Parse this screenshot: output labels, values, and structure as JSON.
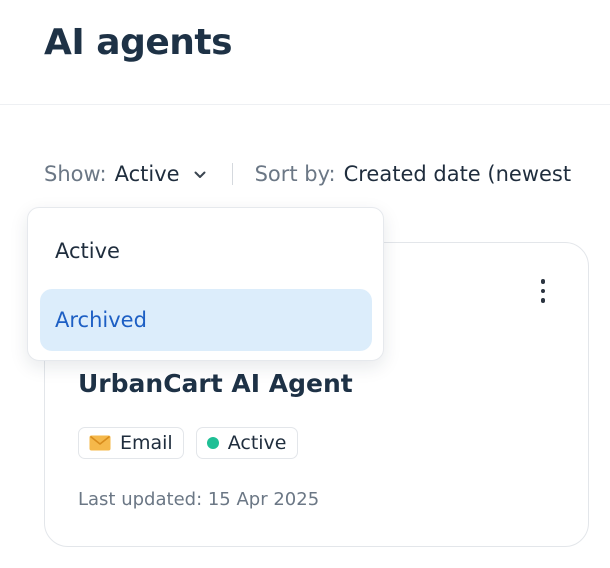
{
  "header": {
    "title": "AI agents"
  },
  "filters": {
    "show_label": "Show:",
    "show_value": "Active",
    "sort_label": "Sort by:",
    "sort_value": "Created date (newest"
  },
  "dropdown": {
    "options": [
      {
        "label": "Active",
        "state": "default"
      },
      {
        "label": "Archived",
        "state": "highlighted"
      }
    ]
  },
  "agent_card": {
    "name": "UrbanCart AI Agent",
    "tags": [
      {
        "label": "Email",
        "icon": "envelope-icon"
      },
      {
        "label": "Active",
        "icon": "status-dot"
      }
    ],
    "last_updated": "Last updated: 15 Apr 2025"
  },
  "colors": {
    "title": "#1e3246",
    "muted_text": "#6b7785",
    "highlight_bg": "#dcedfb",
    "highlight_text": "#1d5fc4",
    "status_active": "#1fbf95",
    "envelope": "#f5b84a"
  }
}
